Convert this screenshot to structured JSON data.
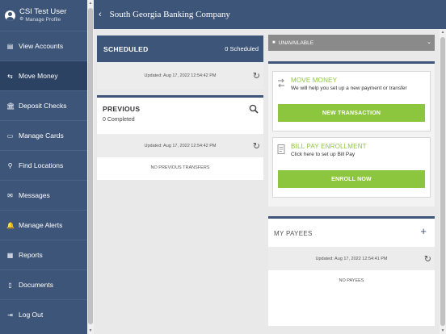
{
  "user": {
    "name": "CSI Test User",
    "manage_profile": "Manage Profile"
  },
  "nav": [
    {
      "id": "view-accounts",
      "label": "View Accounts",
      "icon": "wallet-icon",
      "glyph": "▤"
    },
    {
      "id": "move-money",
      "label": "Move Money",
      "icon": "transfer-icon",
      "glyph": "⇆"
    },
    {
      "id": "deposit-checks",
      "label": "Deposit Checks",
      "icon": "bank-icon",
      "glyph": "🏛"
    },
    {
      "id": "manage-cards",
      "label": "Manage Cards",
      "icon": "card-icon",
      "glyph": "▭"
    },
    {
      "id": "find-locations",
      "label": "Find Locations",
      "icon": "map-pin-icon",
      "glyph": "⚲"
    },
    {
      "id": "messages",
      "label": "Messages",
      "icon": "envelope-icon",
      "glyph": "✉"
    },
    {
      "id": "manage-alerts",
      "label": "Manage Alerts",
      "icon": "bell-icon",
      "glyph": "🔔"
    },
    {
      "id": "reports",
      "label": "Reports",
      "icon": "report-icon",
      "glyph": "▦"
    },
    {
      "id": "documents",
      "label": "Documents",
      "icon": "document-icon",
      "glyph": "▯"
    },
    {
      "id": "log-out",
      "label": "Log Out",
      "icon": "logout-icon",
      "glyph": "⇥"
    }
  ],
  "active_nav": "move-money",
  "header": {
    "title": "South Georgia Banking Company"
  },
  "scheduled": {
    "title": "SCHEDULED",
    "count": "0 Scheduled",
    "updated": "Updated: Aug 17, 2022 12:54:42 PM"
  },
  "previous": {
    "title": "PREVIOUS",
    "count": "0 Completed",
    "updated": "Updated: Aug 17, 2022 12:54:42 PM",
    "empty": "NO PREVIOUS TRANSFERS"
  },
  "account_select": {
    "value": "UNAVAILABLE"
  },
  "move_money": {
    "title": "MOVE MONEY",
    "desc": "We will help you set up a new payment or transfer",
    "button": "NEW TRANSACTION"
  },
  "bill_pay": {
    "title": "BILL PAY ENROLLMENT",
    "desc": "Click here to set up Bill Pay",
    "button": "ENROLL NOW"
  },
  "payees": {
    "title": "MY PAYEES",
    "updated": "Updated: Aug 17, 2022 12:54:41 PM",
    "empty": "NO PAYEES"
  },
  "colors": {
    "navy": "#3d5578",
    "green": "#8cc63f",
    "gray": "#8a8a8a"
  }
}
